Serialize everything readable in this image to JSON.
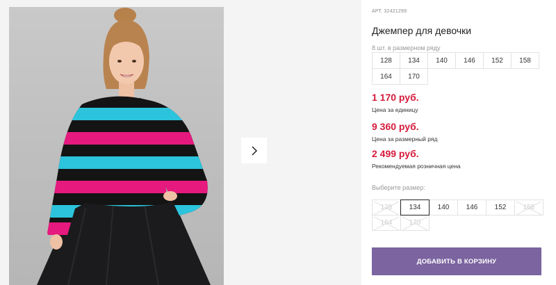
{
  "product": {
    "sku": "АРТ. 32421299",
    "title": "Джемпер для девочки",
    "pack_label": "8 шт. в размерном ряду",
    "pack_sizes": [
      [
        "128",
        "134",
        "140",
        "146",
        "152",
        "158"
      ],
      [
        "164",
        "170"
      ]
    ],
    "prices": [
      {
        "value": "1 170 руб.",
        "note": "Цена за единицу"
      },
      {
        "value": "9 360 руб.",
        "note": "Цена за размерный ряд"
      },
      {
        "value": "2 499 руб.",
        "note": "Рекомендуемая розничная цена"
      }
    ],
    "choose_label": "Выберите размер:",
    "size_options": [
      [
        {
          "label": "128",
          "state": "disabled"
        },
        {
          "label": "134",
          "state": "selected"
        },
        {
          "label": "140",
          "state": "available"
        },
        {
          "label": "146",
          "state": "available"
        },
        {
          "label": "152",
          "state": "available"
        },
        {
          "label": "158",
          "state": "disabled"
        }
      ],
      [
        {
          "label": "164",
          "state": "disabled"
        },
        {
          "label": "170",
          "state": "disabled"
        }
      ]
    ],
    "add_to_cart": "ДОБАВИТЬ В КОРЗИНУ"
  },
  "gallery": {
    "next_icon": "chevron-right-icon"
  },
  "colors": {
    "price": "#d51b3c",
    "button": "#7b64a0",
    "stripe_pink": "#e6197e",
    "stripe_cyan": "#2cc4dc",
    "stripe_black": "#141414"
  }
}
